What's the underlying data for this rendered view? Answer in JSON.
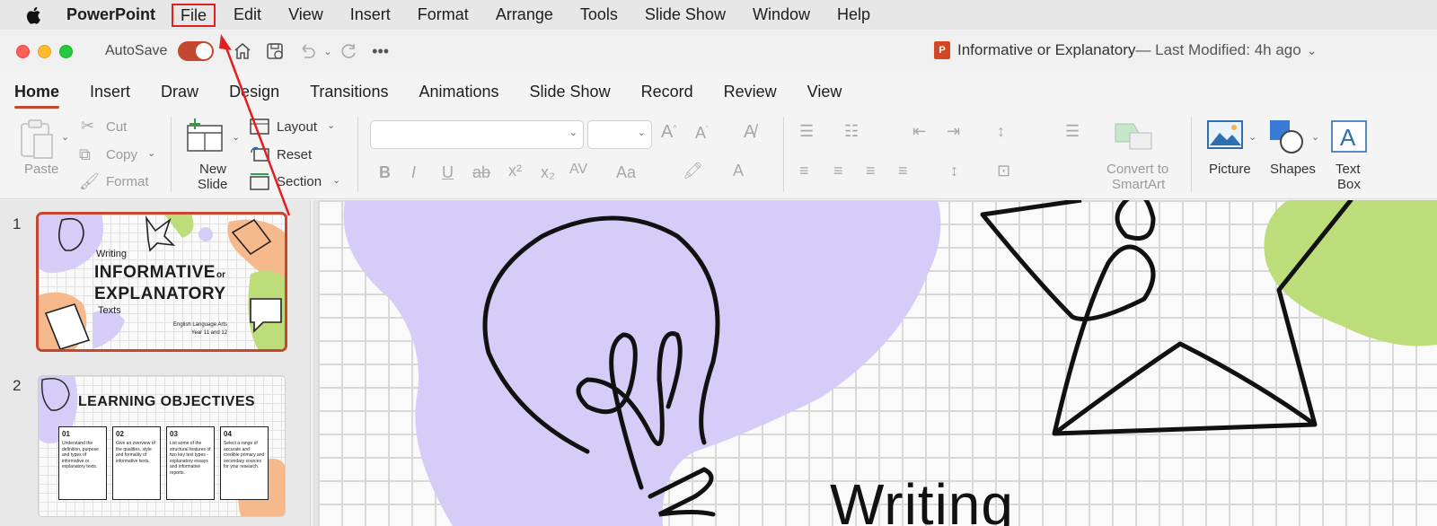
{
  "menubar": {
    "app_name": "PowerPoint",
    "items": [
      "File",
      "Edit",
      "View",
      "Insert",
      "Format",
      "Arrange",
      "Tools",
      "Slide Show",
      "Window",
      "Help"
    ]
  },
  "titlebar": {
    "autosave_label": "AutoSave",
    "autosave_on": true,
    "doc_title": "Informative or Explanatory",
    "last_modified": " — Last Modified: 4h ago"
  },
  "tabs": [
    "Home",
    "Insert",
    "Draw",
    "Design",
    "Transitions",
    "Animations",
    "Slide Show",
    "Record",
    "Review",
    "View"
  ],
  "active_tab": "Home",
  "ribbon": {
    "paste": "Paste",
    "cut": "Cut",
    "copy": "Copy",
    "format": "Format",
    "new_slide_line1": "New",
    "new_slide_line2": "Slide",
    "layout": "Layout",
    "reset": "Reset",
    "section": "Section",
    "convert_line1": "Convert to",
    "convert_line2": "SmartArt",
    "picture": "Picture",
    "shapes": "Shapes",
    "textbox_line1": "Text",
    "textbox_line2": "Box",
    "font_name": "",
    "font_size": ""
  },
  "slides": [
    {
      "number": "1",
      "small_title": "Writing",
      "title_line1": "INFORMATIVE",
      "title_or": "or",
      "title_line2": "EXPLANATORY",
      "subtitle": "Texts",
      "footer1": "English Language Arts",
      "footer2": "Year 11 and 12"
    },
    {
      "number": "2",
      "title": "LEARNING OBJECTIVES",
      "boxes": [
        {
          "num": "01",
          "text": "Understand the definition, purpose and types of informative or explanatory texts."
        },
        {
          "num": "02",
          "text": "Give an overview of the qualities, style and formality of informative texts."
        },
        {
          "num": "03",
          "text": "List some of the structural features of two key text types - explanatory essays and informative reports."
        },
        {
          "num": "04",
          "text": "Select a range of accurate and credible primary and secondary sources for your research."
        }
      ]
    }
  ],
  "main_slide": {
    "visible_title": "Writing"
  },
  "colors": {
    "accent": "#c4482f",
    "lavender": "#d5cdf7",
    "green": "#bddc7a",
    "peach": "#f6b98c"
  }
}
